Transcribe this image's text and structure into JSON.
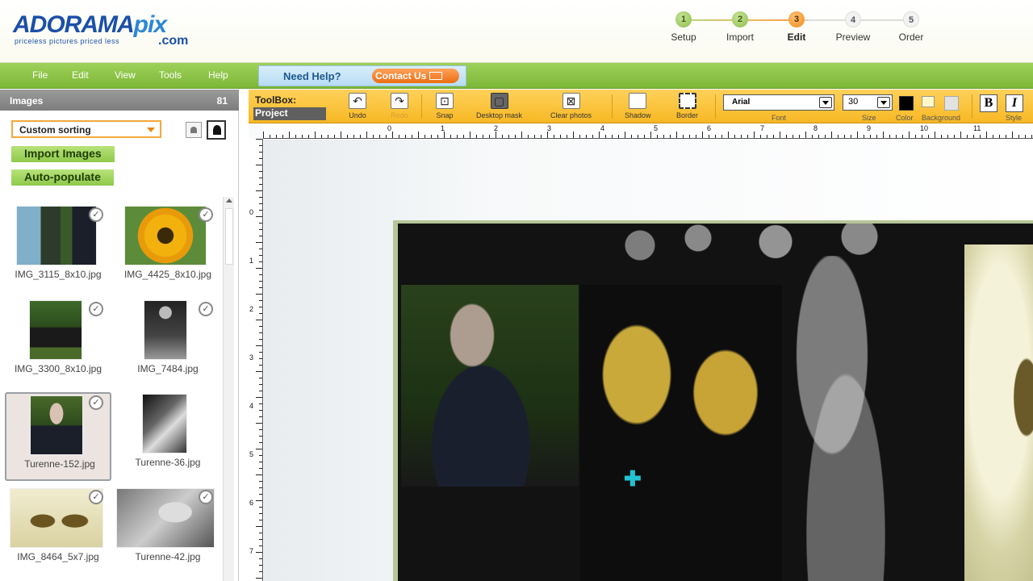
{
  "header": {
    "logo_main": "ADORAMA",
    "logo_pix": "pix",
    "logo_com": ".com",
    "logo_tagline": "priceless pictures priced less",
    "steps": [
      {
        "num": "1",
        "label": "Setup",
        "state": "done"
      },
      {
        "num": "2",
        "label": "Import",
        "state": "done"
      },
      {
        "num": "3",
        "label": "Edit",
        "state": "active"
      },
      {
        "num": "4",
        "label": "Preview",
        "state": "todo"
      },
      {
        "num": "5",
        "label": "Order",
        "state": "todo"
      }
    ]
  },
  "menubar": {
    "items": [
      "File",
      "Edit",
      "View",
      "Tools",
      "Help"
    ],
    "need_help": "Need Help?",
    "contact": "Contact Us"
  },
  "images_panel": {
    "title": "Images",
    "count": "81",
    "sort": "Custom sorting",
    "import_label": "Import Images",
    "autopop_label": "Auto-populate",
    "thumbs": [
      {
        "name": "IMG_3115_8x10.jpg",
        "checked": "✓"
      },
      {
        "name": "IMG_4425_8x10.jpg",
        "checked": "✓"
      },
      {
        "name": "IMG_3300_8x10.jpg",
        "checked": "✓"
      },
      {
        "name": "IMG_7484.jpg",
        "checked": "✓"
      },
      {
        "name": "Turenne-152.jpg",
        "checked": "✓"
      },
      {
        "name": "Turenne-36.jpg",
        "checked": ""
      },
      {
        "name": "IMG_8464_5x7.jpg",
        "checked": "✓"
      },
      {
        "name": "Turenne-42.jpg",
        "checked": "✓"
      }
    ]
  },
  "toolbox": {
    "title": "ToolBox:",
    "mode": "Project",
    "undo": "Undo",
    "redo": "Redo",
    "snap": "Snap",
    "desktop_mask": "Desktop mask",
    "clear_photos": "Clear photos",
    "shadow": "Shadow",
    "border": "Border",
    "font_value": "Arial",
    "font_label": "Font",
    "size_value": "30",
    "size_label": "Size",
    "color_label": "Color",
    "background_label": "Background",
    "style_label": "Style",
    "bold": "B",
    "italic": "I"
  },
  "ruler": {
    "h_ticks": [
      "0",
      "1",
      "2",
      "3",
      "4",
      "5",
      "6",
      "7",
      "8",
      "9",
      "10",
      "11"
    ],
    "v_ticks": [
      "0",
      "1",
      "2",
      "3",
      "4",
      "5",
      "6",
      "7"
    ]
  },
  "colors": {
    "menubar_green": "#8cc63f",
    "toolbox_orange": "#f7b824",
    "active_step": "#f08a12",
    "brand_blue": "#1b4fa8"
  }
}
